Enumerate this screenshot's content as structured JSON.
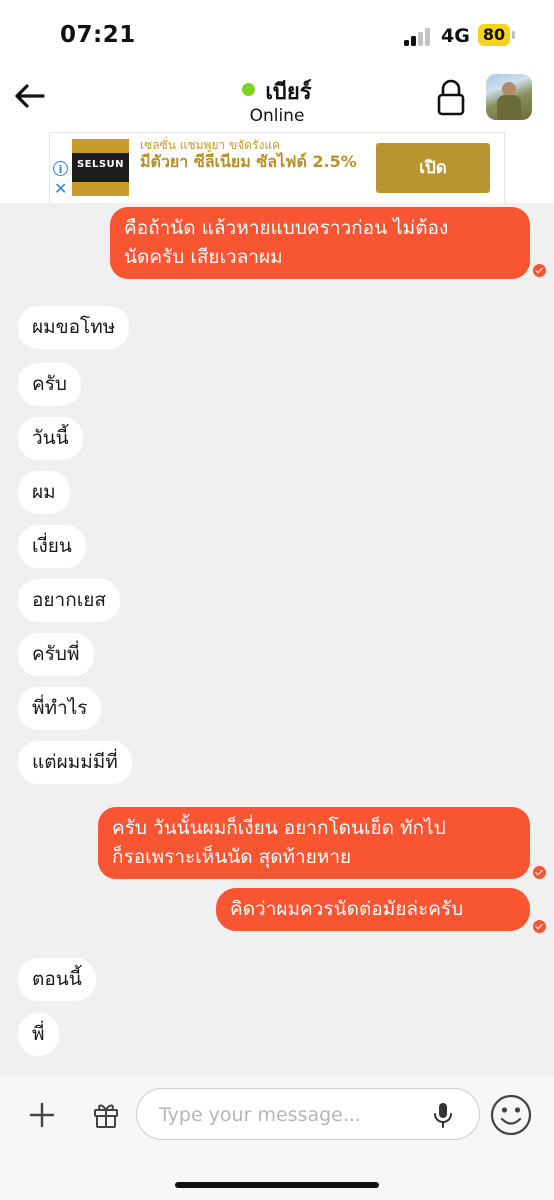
{
  "status_bar": {
    "time": "07:21",
    "network": "4G",
    "battery": "80"
  },
  "header": {
    "contact_name": "เบียร์",
    "presence": "Online",
    "presence_color": "#7ed321"
  },
  "ad": {
    "logo_text": "SELSUN",
    "brand_line": "เซลซั่น แชมพูยา ขจัดรังแค",
    "headline": "มีตัวยา ซีลีเนียม ซัลไฟด์ 2.5%",
    "cta": "เปิด",
    "accent": "#b99530"
  },
  "colors": {
    "outgoing_bubble": "#f85532",
    "incoming_bubble": "#ffffff",
    "chat_bg": "#f0f0f0"
  },
  "messages": [
    {
      "direction": "out",
      "lines": [
        "คือถ้านัด แล้วหายแบบคราวก่อน ไม่ต้อง",
        "นัดครับ เสียเวลาผม"
      ]
    },
    {
      "direction": "in",
      "text": "ผมขอโทษ"
    },
    {
      "direction": "in",
      "text": "ครับ"
    },
    {
      "direction": "in",
      "text": "วันนี้"
    },
    {
      "direction": "in",
      "text": "ผม"
    },
    {
      "direction": "in",
      "text": "เงี่ยน"
    },
    {
      "direction": "in",
      "text": "อยากเยส"
    },
    {
      "direction": "in",
      "text": "ครับพี่"
    },
    {
      "direction": "in",
      "text": "พี่ทำไร"
    },
    {
      "direction": "in",
      "text": "แต่ผมม่มีที่"
    },
    {
      "direction": "out",
      "lines": [
        "ครับ วันนั้นผมก็เงี่ยน อยากโดนเย็ด ทักไป",
        "ก็รอเพราะเห็นนัด สุดท้ายหาย"
      ]
    },
    {
      "direction": "out",
      "text": "คิดว่าผมควรนัดต่อมัยล่ะครับ"
    },
    {
      "direction": "in",
      "text": "ตอนนี้"
    },
    {
      "direction": "in",
      "text": "พี่"
    }
  ],
  "composer": {
    "placeholder": "Type your message..."
  },
  "icons": [
    "back-arrow-icon",
    "lock-icon",
    "info-icon",
    "close-icon",
    "plus-icon",
    "gift-icon",
    "mic-icon",
    "emoji-icon"
  ]
}
